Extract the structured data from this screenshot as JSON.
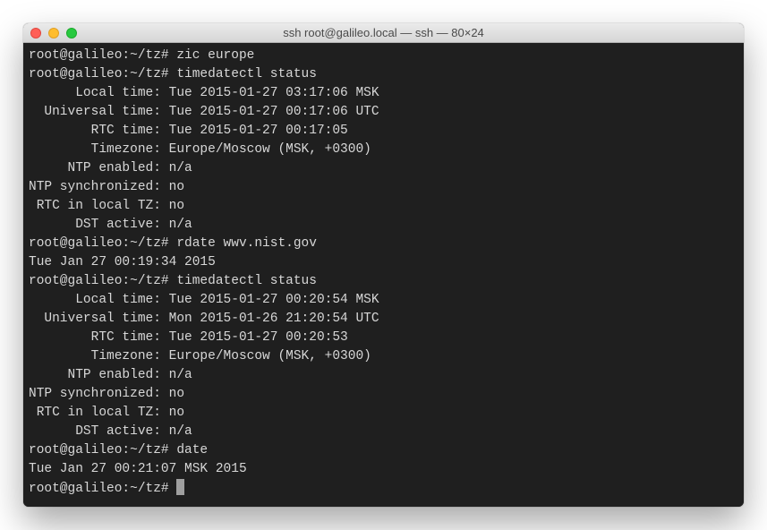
{
  "window": {
    "title": "ssh root@galileo.local — ssh — 80×24"
  },
  "terminal": {
    "prompt": "root@galileo:~/tz# ",
    "lines": [
      {
        "type": "cmd",
        "text": "zic europe"
      },
      {
        "type": "cmd",
        "text": "timedatectl status"
      },
      {
        "type": "out",
        "text": "      Local time: Tue 2015-01-27 03:17:06 MSK"
      },
      {
        "type": "out",
        "text": "  Universal time: Tue 2015-01-27 00:17:06 UTC"
      },
      {
        "type": "out",
        "text": "        RTC time: Tue 2015-01-27 00:17:05"
      },
      {
        "type": "out",
        "text": "        Timezone: Europe/Moscow (MSK, +0300)"
      },
      {
        "type": "out",
        "text": "     NTP enabled: n/a"
      },
      {
        "type": "out",
        "text": "NTP synchronized: no"
      },
      {
        "type": "out",
        "text": " RTC in local TZ: no"
      },
      {
        "type": "out",
        "text": "      DST active: n/a"
      },
      {
        "type": "cmd",
        "text": "rdate wwv.nist.gov"
      },
      {
        "type": "out",
        "text": "Tue Jan 27 00:19:34 2015"
      },
      {
        "type": "cmd",
        "text": "timedatectl status"
      },
      {
        "type": "out",
        "text": "      Local time: Tue 2015-01-27 00:20:54 MSK"
      },
      {
        "type": "out",
        "text": "  Universal time: Mon 2015-01-26 21:20:54 UTC"
      },
      {
        "type": "out",
        "text": "        RTC time: Tue 2015-01-27 00:20:53"
      },
      {
        "type": "out",
        "text": "        Timezone: Europe/Moscow (MSK, +0300)"
      },
      {
        "type": "out",
        "text": "     NTP enabled: n/a"
      },
      {
        "type": "out",
        "text": "NTP synchronized: no"
      },
      {
        "type": "out",
        "text": " RTC in local TZ: no"
      },
      {
        "type": "out",
        "text": "      DST active: n/a"
      },
      {
        "type": "cmd",
        "text": "date"
      },
      {
        "type": "out",
        "text": "Tue Jan 27 00:21:07 MSK 2015"
      },
      {
        "type": "cmd",
        "text": "",
        "cursor": true
      }
    ]
  }
}
